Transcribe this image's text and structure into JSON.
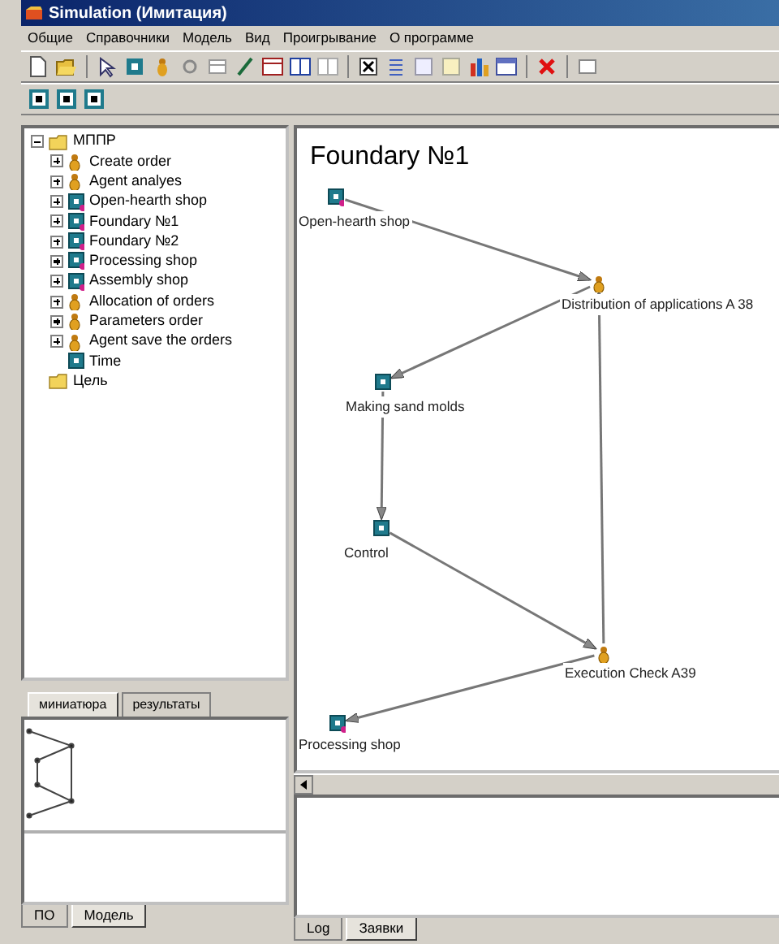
{
  "window": {
    "title": "Simulation (Имитация)"
  },
  "menu": [
    "Общие",
    "Справочники",
    "Модель",
    "Вид",
    "Проигрывание",
    "О программе"
  ],
  "tree": [
    {
      "label": "МППР",
      "kind": "folder",
      "expandable": true,
      "expanded": true,
      "children": [
        {
          "label": "Create order",
          "kind": "agent",
          "expandable": true,
          "expanded": false
        },
        {
          "label": "Agent analyes",
          "kind": "agent",
          "expandable": true,
          "expanded": false
        },
        {
          "label": "Open-hearth shop",
          "kind": "shop",
          "expandable": true,
          "expanded": false
        },
        {
          "label": "Foundary №1",
          "kind": "shop",
          "expandable": true,
          "expanded": false
        },
        {
          "label": "Foundary №2",
          "kind": "shop",
          "expandable": true,
          "expanded": false
        },
        {
          "label": "Processing shop",
          "kind": "shop",
          "expandable": true,
          "expanded": false
        },
        {
          "label": "Assembly shop",
          "kind": "shop",
          "expandable": true,
          "expanded": false
        },
        {
          "label": "Allocation of orders",
          "kind": "agent",
          "expandable": true,
          "expanded": false
        },
        {
          "label": "Parameters order",
          "kind": "agent",
          "expandable": true,
          "expanded": false
        },
        {
          "label": "Agent save the orders",
          "kind": "agent",
          "expandable": true,
          "expanded": false
        },
        {
          "label": "Time",
          "kind": "time",
          "expandable": false,
          "expanded": false
        }
      ]
    },
    {
      "label": "Цель",
      "kind": "folder",
      "expandable": false,
      "expanded": false
    }
  ],
  "view_tabs": [
    {
      "label": "миниатюра",
      "selected": true
    },
    {
      "label": "результаты",
      "selected": false
    }
  ],
  "left_tabs": [
    {
      "label": "ПО",
      "selected": false
    },
    {
      "label": "Модель",
      "selected": true
    }
  ],
  "diagram": {
    "title": "Foundary №1",
    "nodes": [
      {
        "label": "Open-hearth shop",
        "kind": "shop"
      },
      {
        "label": "Distribution of applications A 38",
        "kind": "agent"
      },
      {
        "label": "Making sand molds",
        "kind": "process"
      },
      {
        "label": "Control",
        "kind": "process"
      },
      {
        "label": "Execution Check A39",
        "kind": "agent"
      },
      {
        "label": "Processing shop",
        "kind": "shop"
      }
    ]
  },
  "bottom_tabs": [
    {
      "label": "Log",
      "selected": false
    },
    {
      "label": "Заявки",
      "selected": true
    }
  ]
}
